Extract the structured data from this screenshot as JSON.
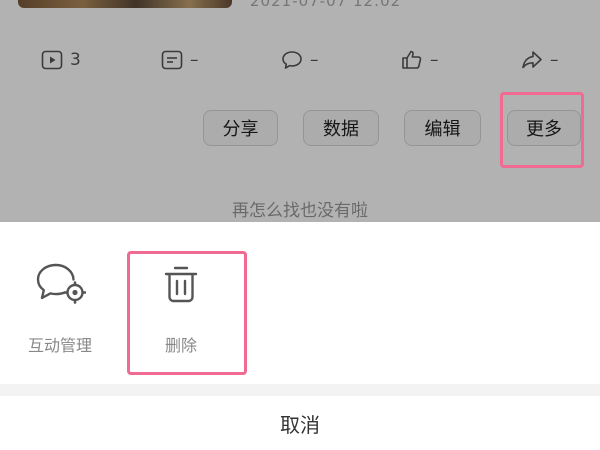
{
  "background": {
    "date_text": "2021-07-07 12:02",
    "stats": {
      "plays": "3",
      "danmaku": "–",
      "comments": "–",
      "likes": "–",
      "shares": "–"
    },
    "buttons": {
      "share": "分享",
      "data": "数据",
      "edit": "编辑",
      "more": "更多"
    },
    "footer_note": "再怎么找也没有啦"
  },
  "sheet": {
    "actions": [
      {
        "label": "互动管理",
        "icon": "comment-settings-icon"
      },
      {
        "label": "删除",
        "icon": "trash-icon"
      }
    ],
    "cancel_label": "取消"
  },
  "colors": {
    "highlight": "#f06a92",
    "overlay": "rgba(0,0,0,0.30)"
  }
}
